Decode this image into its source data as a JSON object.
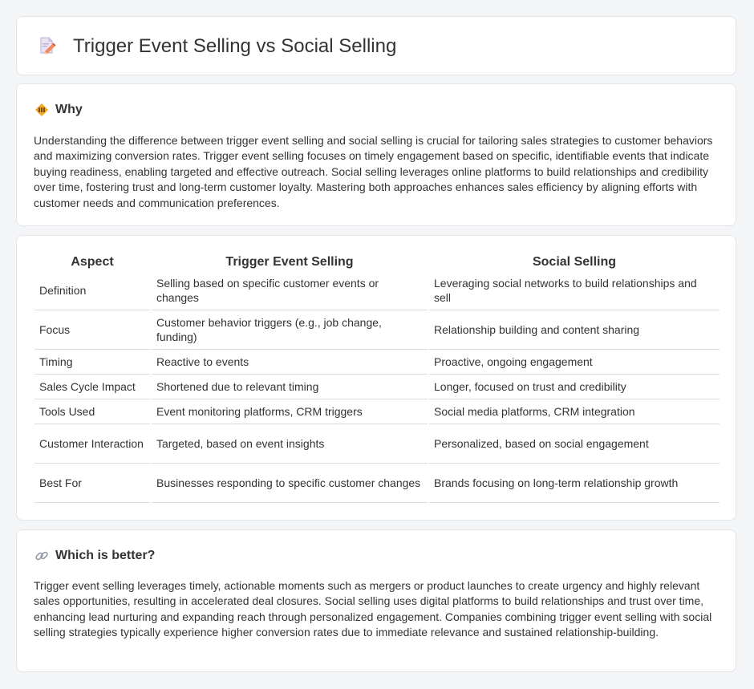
{
  "header": {
    "title": "Trigger Event Selling vs Social Selling",
    "icon": "document-pencil-icon"
  },
  "why": {
    "icon": "diamond-warning-icon",
    "title": "Why",
    "text": "Understanding the difference between trigger event selling and social selling is crucial for tailoring sales strategies to customer behaviors and maximizing conversion rates. Trigger event selling focuses on timely engagement based on specific, identifiable events that indicate buying readiness, enabling targeted and effective outreach. Social selling leverages online platforms to build relationships and credibility over time, fostering trust and long-term customer loyalty. Mastering both approaches enhances sales efficiency by aligning efforts with customer needs and communication preferences."
  },
  "table": {
    "headers": [
      "Aspect",
      "Trigger Event Selling",
      "Social Selling"
    ],
    "rows": [
      [
        "Definition",
        "Selling based on specific customer events or changes",
        "Leveraging social networks to build relationships and sell"
      ],
      [
        "Focus",
        "Customer behavior triggers (e.g., job change, funding)",
        "Relationship building and content sharing"
      ],
      [
        "Timing",
        "Reactive to events",
        "Proactive, ongoing engagement"
      ],
      [
        "Sales Cycle Impact",
        "Shortened due to relevant timing",
        "Longer, focused on trust and credibility"
      ],
      [
        "Tools Used",
        "Event monitoring platforms, CRM triggers",
        "Social media platforms, CRM integration"
      ],
      [
        "Customer Interaction",
        "Targeted, based on event insights",
        "Personalized, based on social engagement"
      ],
      [
        "Best For",
        "Businesses responding to specific customer changes",
        "Brands focusing on long-term relationship growth"
      ]
    ]
  },
  "better": {
    "icon": "link-icon",
    "title": "Which is better?",
    "text": "Trigger event selling leverages timely, actionable moments such as mergers or product launches to create urgency and highly relevant sales opportunities, resulting in accelerated deal closures. Social selling uses digital platforms to build relationships and trust over time, enhancing lead nurturing and expanding reach through personalized engagement. Companies combining trigger event selling with social selling strategies typically experience higher conversion rates due to immediate relevance and sustained relationship-building."
  },
  "colors": {
    "page_bg": "#f4f5f7",
    "card_bg": "#ffffff",
    "text": "#333333",
    "icon_orange": "#f5a623"
  }
}
